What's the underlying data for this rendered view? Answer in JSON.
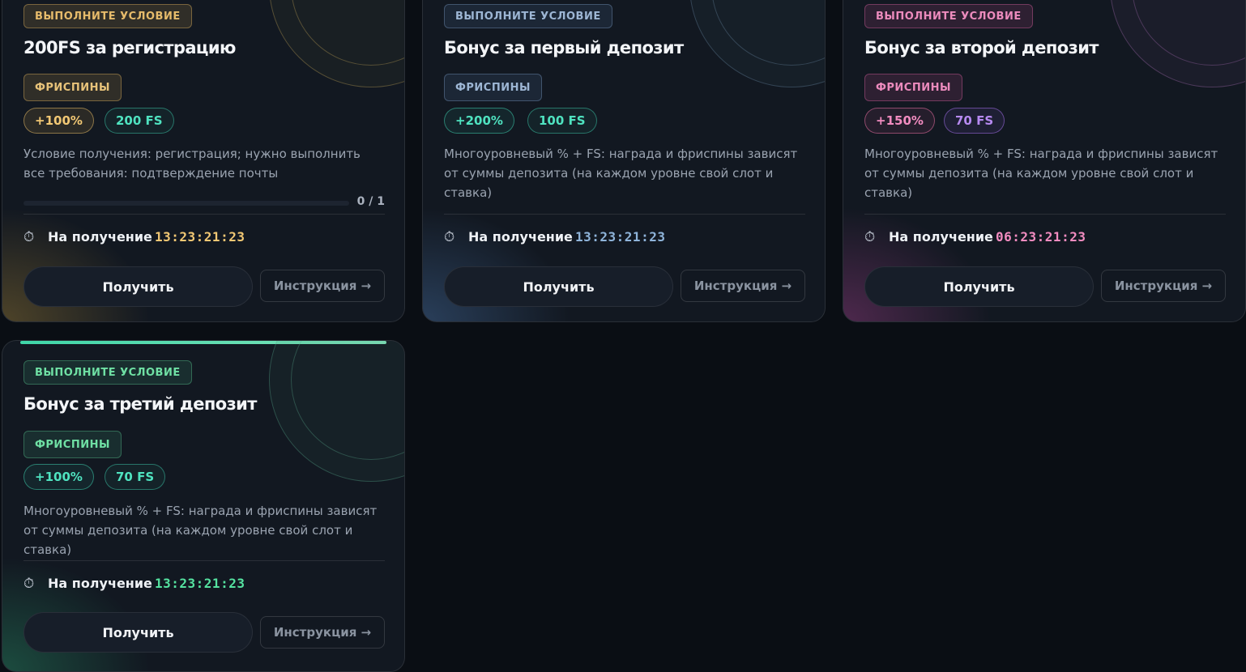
{
  "cards": [
    {
      "status": "ВЫПОЛНИТЕ УСЛОВИЕ",
      "title": "200FS за регистрацию",
      "type": "ФРИСПИНЫ",
      "percent": "+100%",
      "fs": "200 FS",
      "description": "Условие получения: регистрация; нужно выполнить все требования: подтверждение почты",
      "progress": {
        "text": "0 / 1",
        "current": 0,
        "total": 1
      },
      "timer_label": "На получение",
      "timer_value": "13:23:21:23",
      "get_label": "Получить",
      "instruction_label": "Инструкция →",
      "accent": "#e6bb6b"
    },
    {
      "status": "ВЫПОЛНИТЕ УСЛОВИЕ",
      "title": "Бонус за первый депозит",
      "type": "ФРИСПИНЫ",
      "percent": "+200%",
      "fs": "100 FS",
      "description": "Многоуровневый % + FS: награда и фриспины зависят от суммы депозита (на каждом уровне свой слот и ставка)",
      "timer_label": "На получение",
      "timer_value": "13:23:21:23",
      "get_label": "Получить",
      "instruction_label": "Инструкция →",
      "accent": "#9db6d4"
    },
    {
      "status": "ВЫПОЛНИТЕ УСЛОВИЕ",
      "title": "Бонус за второй депозит",
      "type": "ФРИСПИНЫ",
      "percent": "+150%",
      "fs": "70 FS",
      "description": "Многоуровневый % + FS: награда и фриспины зависят от суммы депозита (на каждом уровне свой слот и ставка)",
      "timer_label": "На получение",
      "timer_value": "06:23:21:23",
      "get_label": "Получить",
      "instruction_label": "Инструкция →",
      "accent": "#ec8bbd"
    },
    {
      "status": "ВЫПОЛНИТЕ УСЛОВИЕ",
      "title": "Бонус за третий депозит",
      "type": "ФРИСПИНЫ",
      "percent": "+100%",
      "fs": "70 FS",
      "description": "Многоуровневый % + FS: награда и фриспины зависят от суммы депозита (на каждом уровне свой слот и ставка)",
      "timer_label": "На получение",
      "timer_value": "13:23:21:23",
      "get_label": "Получить",
      "instruction_label": "Инструкция →",
      "accent": "#6fe0a4"
    }
  ],
  "icons": {
    "timer": "stopwatch-icon"
  }
}
